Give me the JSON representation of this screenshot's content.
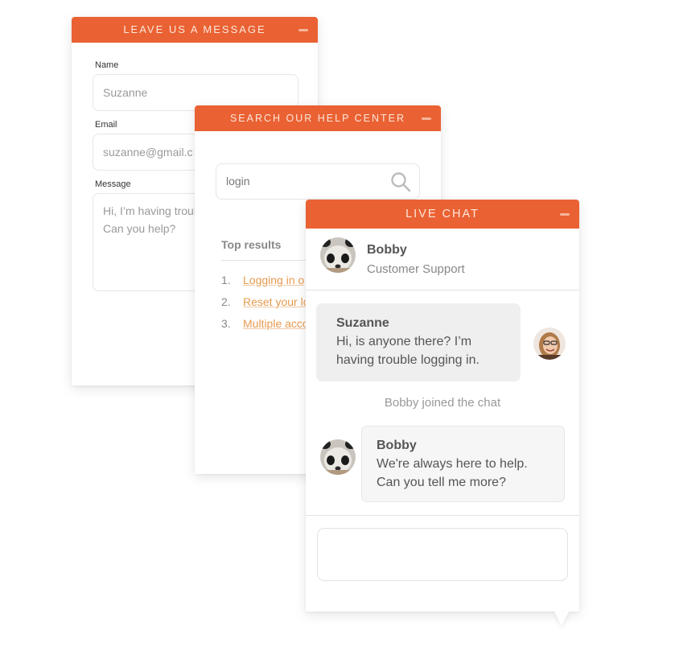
{
  "message_panel": {
    "title": "LEAVE US A MESSAGE",
    "fields": {
      "name": {
        "label": "Name",
        "value": "Suzanne"
      },
      "email": {
        "label": "Email",
        "value": "suzanne@gmail.c"
      },
      "message": {
        "label": "Message",
        "line1": "Hi, I’m having troub",
        "line2": "Can you help?"
      }
    }
  },
  "help_panel": {
    "title": "SEARCH OUR HELP CENTER",
    "search": {
      "value": "login",
      "icon": "search-icon"
    },
    "top_results_label": "Top results",
    "results": [
      {
        "num": "1.",
        "text": "Logging in o"
      },
      {
        "num": "2.",
        "text": "Reset your lo"
      },
      {
        "num": "3.",
        "text": "Multiple acco"
      }
    ]
  },
  "chat_panel": {
    "title": "LIVE CHAT",
    "agent": {
      "name": "Bobby",
      "role": "Customer Support",
      "avatar": "panda-avatar"
    },
    "messages": [
      {
        "sender": "Suzanne",
        "line1": "Hi, is anyone there? I’m",
        "line2": "having trouble logging in.",
        "avatar": "suzanne-avatar"
      },
      {
        "system": "Bobby joined the chat"
      },
      {
        "sender": "Bobby",
        "line1": "We're always here to help.",
        "line2": "Can you tell me more?",
        "avatar": "panda-avatar"
      }
    ],
    "composer": {
      "value": ""
    }
  },
  "colors": {
    "accent": "#ea6233",
    "link": "#e79a4f",
    "bubble_user": "#efefef",
    "bubble_agent": "#f6f6f6"
  }
}
